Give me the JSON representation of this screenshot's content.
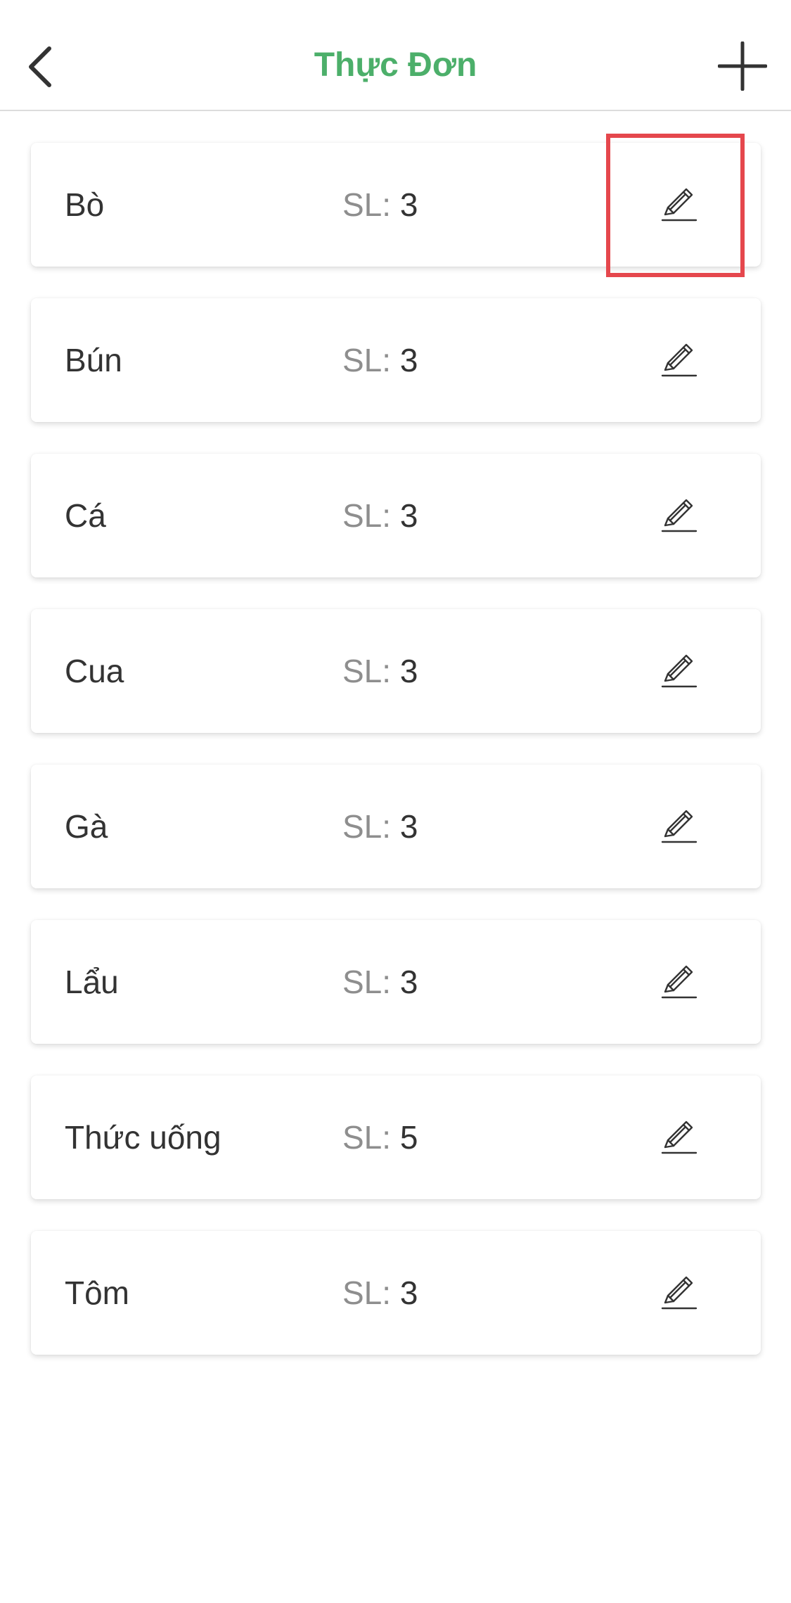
{
  "header": {
    "title": "Thực Đơn",
    "title_color": "#4caf6a",
    "back_icon": "chevron-left-icon",
    "add_icon": "plus-icon"
  },
  "qty_label": "SL:",
  "edit_icon": "pencil-icon",
  "highlight_color": "#e5474d",
  "items": [
    {
      "name": "Bò",
      "qty": "3"
    },
    {
      "name": "Bún",
      "qty": "3"
    },
    {
      "name": "Cá",
      "qty": "3"
    },
    {
      "name": "Cua",
      "qty": "3"
    },
    {
      "name": "Gà",
      "qty": "3"
    },
    {
      "name": "Lẩu",
      "qty": "3"
    },
    {
      "name": "Thức uống",
      "qty": "5"
    },
    {
      "name": "Tôm",
      "qty": "3"
    }
  ]
}
